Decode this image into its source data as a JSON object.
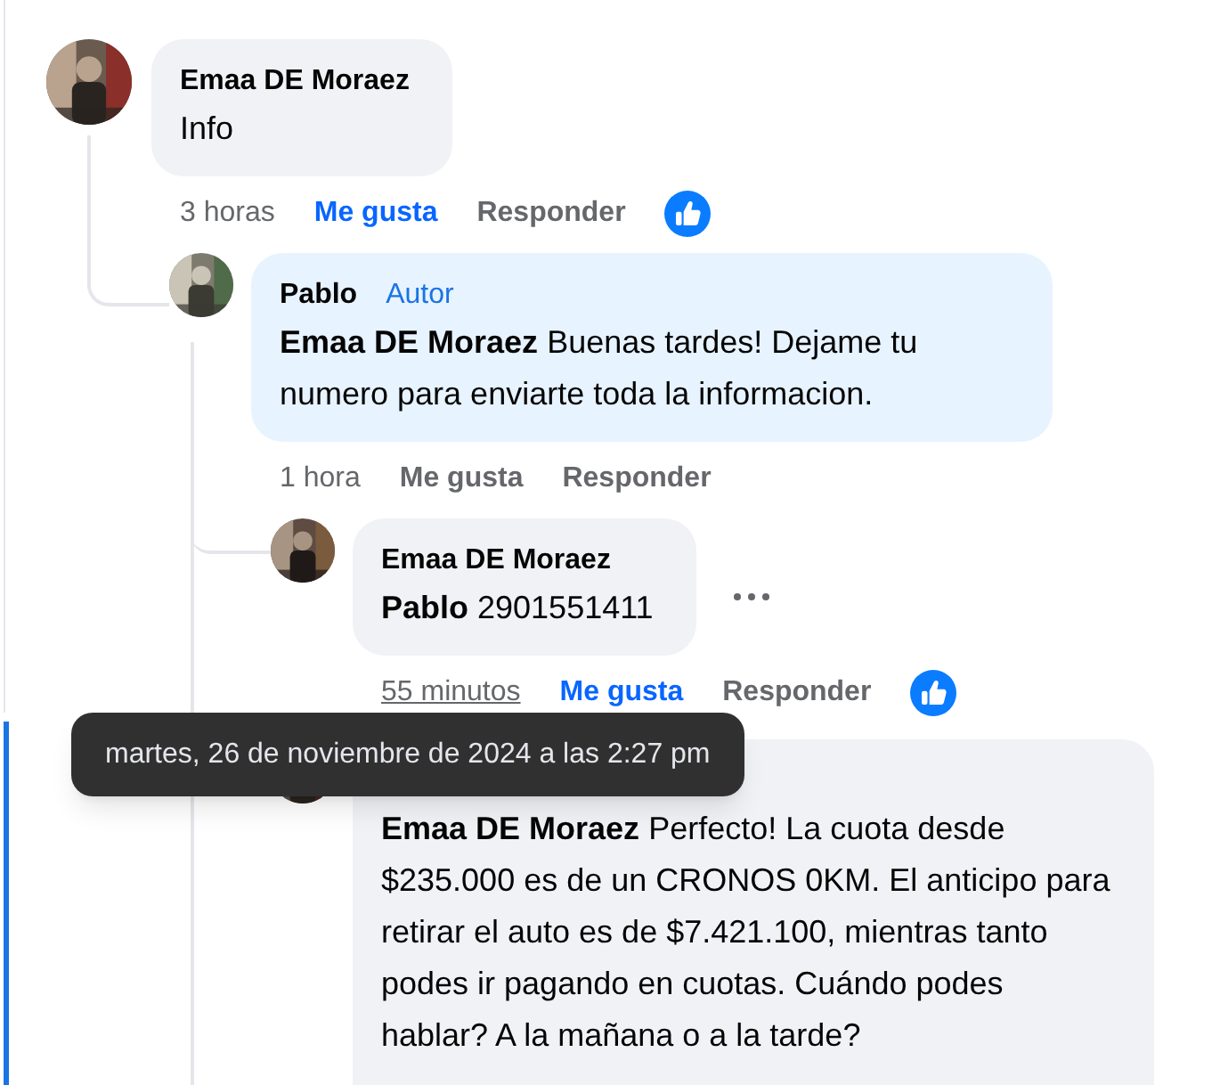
{
  "comments": [
    {
      "author": "Emaa DE Moraez",
      "text": "Info",
      "time": "3 horas",
      "time_hovered": false,
      "like_label": "Me gusta",
      "liked": true,
      "reply_label": "Responder",
      "reaction": true,
      "show_more": false,
      "children": [
        {
          "author": "Pablo",
          "badge": "Autor",
          "text": "**Emaa DE Moraez** Buenas tardes! Dejame tu numero para enviarte toda la informacion.",
          "time": "1 hora",
          "time_hovered": false,
          "like_label": "Me gusta",
          "liked": false,
          "reply_label": "Responder",
          "reaction": false,
          "show_more": false,
          "children": [
            {
              "author": "Emaa DE Moraez",
              "text": "**Pablo** 2901551411",
              "time": "55 minutos",
              "time_hovered": true,
              "like_label": "Me gusta",
              "liked": true,
              "reply_label": "Responder",
              "reaction": true,
              "show_more": true
            },
            {
              "text": "**Emaa DE Moraez** Perfecto! La cuota desde $235.000 es de un CRONOS 0KM. El anticipo para retirar el auto es de $7.421.100, mientras tanto podes ir pagando en cuotas. Cuándo podes hablar? A la mañana o a la tarde?"
            }
          ]
        }
      ]
    }
  ],
  "tooltip": "martes, 26 de noviembre de 2024 a las 2:27 pm"
}
